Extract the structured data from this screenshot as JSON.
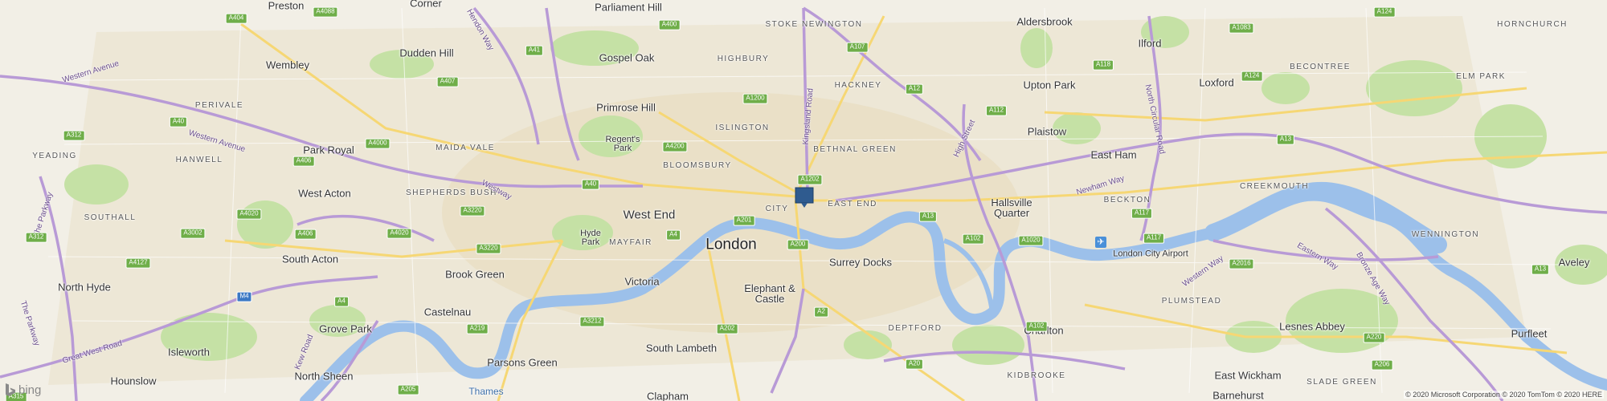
{
  "map": {
    "view": "road",
    "colors": {
      "land": "#f2efe6",
      "urban": "#ebe4cf",
      "water": "#9cc0ea",
      "park": "#c5e1a5",
      "motorway": "#b89ad6",
      "major_road": "#f6d774"
    },
    "places": {
      "london": "London",
      "preston": "Preston",
      "parliament_hill": "Parliament Hill",
      "stoke_newington": "STOKE NEWINGTON",
      "aldersbrook": "Aldersbrook",
      "ilford": "Ilford",
      "dudden_hill": "Dudden Hill",
      "gospel_oak": "Gospel Oak",
      "highbury": "HIGHBURY",
      "hackney": "HACKNEY",
      "upton_park": "Upton Park",
      "loxford": "Loxford",
      "becontree": "BECONTREE",
      "elm_park": "ELM PARK",
      "hornchurch": "HORNCHURCH",
      "wembley": "Wembley",
      "primrose_hill": "Primrose Hill",
      "islington": "ISLINGTON",
      "plaistow": "Plaistow",
      "perivale": "PERIVALE",
      "regents_park": "Regent's Park",
      "park_royal": "Park Royal",
      "maida_vale": "MAIDA VALE",
      "bloomsbury": "BLOOMSBURY",
      "bethnal_green": "BETHNAL GREEN",
      "east_ham": "East Ham",
      "yeading": "YEADING",
      "hanwell": "HANWELL",
      "west_acton": "West Acton",
      "shepherds_bush": "SHEPHERDS BUSH",
      "creekmouth": "CREEKMOUTH",
      "beckton": "BECKTON",
      "west_end": "West End",
      "city": "CITY",
      "east_end": "EAST END",
      "hallsville_quarter": "Hallsville Quarter",
      "southall": "SOUTHALL",
      "hyde_park": "Hyde Park",
      "mayfair": "MAYFAIR",
      "wennington": "WENNINGTON",
      "london_city_airport": "London City Airport",
      "aveley": "Aveley",
      "south_acton": "South Acton",
      "surrey_docks": "Surrey Docks",
      "north_hyde": "North Hyde",
      "brook_green": "Brook Green",
      "victoria": "Victoria",
      "elephant_castle": "Elephant & Castle",
      "plumstead": "PLUMSTEAD",
      "purfleet": "Purfleet",
      "castelnau": "Castelnau",
      "grove_park": "Grove Park",
      "deptford": "DEPTFORD",
      "charlton": "Charlton",
      "lesnes_abbey": "Lesnes Abbey",
      "isleworth": "Isleworth",
      "south_lambeth": "South Lambeth",
      "parsons_green": "Parsons Green",
      "north_sheen": "North Sheen",
      "east_wickham": "East Wickham",
      "hounslow": "Hounslow",
      "thames": "Thames",
      "clapham": "Clapham",
      "kidbrooke": "KIDBROOKE",
      "barnehurst": "Barnehurst",
      "slade_green": "SLADE GREEN",
      "corner": "Corner"
    },
    "roads": {
      "western_avenue_1": "Western Avenue",
      "western_avenue_2": "Western Avenue",
      "westway": "Westway",
      "kingsland_road": "Kingsland Road",
      "high_street": "High Street",
      "north_circular_road": "North Circular Road",
      "newham_way": "Newham Way",
      "great_west_road": "Great West Road",
      "the_parkway_1": "The Parkway",
      "the_parkway_2": "The Parkway",
      "kew_road": "Kew Road",
      "hendon_way": "Hendon Way",
      "eastern_way": "Eastern Way",
      "western_way": "Western Way",
      "bronze_age_way": "Bronze Age Way"
    },
    "shields": {
      "a404": "A404",
      "a4088": "A4088",
      "a400": "A400",
      "a41": "A41",
      "a107": "A107",
      "a1083": "A1083",
      "a124_top": "A124",
      "a118": "A118",
      "a407": "A407",
      "a1200": "A1200",
      "a12": "A12",
      "a112": "A112",
      "a124": "A124",
      "a40_w": "A40",
      "a4000": "A4000",
      "a312": "A312",
      "a4200": "A4200",
      "a406": "A406",
      "a1202": "A1202",
      "a13_e": "A13",
      "a40": "A40",
      "a3220_1": "A3220",
      "a4020_1": "A4020",
      "a201": "A201",
      "a13": "A13",
      "a117_1": "A117",
      "a3002": "A3002",
      "a406_2": "A406",
      "a4020_2": "A4020",
      "a4": "A4",
      "a200": "A200",
      "a102_1": "A102",
      "a1020": "A1020",
      "a117_2": "A117",
      "a2016": "A2016",
      "a3220_2": "A3220",
      "a312_2": "A312",
      "a4127": "A4127",
      "a13_far": "A13",
      "a4_2": "A4",
      "a2": "A2",
      "m4": "M4",
      "a3212": "A3212",
      "a219": "A219",
      "a202": "A202",
      "a102_2": "A102",
      "a220": "A220",
      "a20": "A20",
      "a205": "A205",
      "a206": "A206",
      "a315": "A315"
    },
    "pin": "location-pin",
    "branding": "bing",
    "copyright": "© 2020 Microsoft Corporation © 2020 TomTom © 2020 HERE"
  }
}
